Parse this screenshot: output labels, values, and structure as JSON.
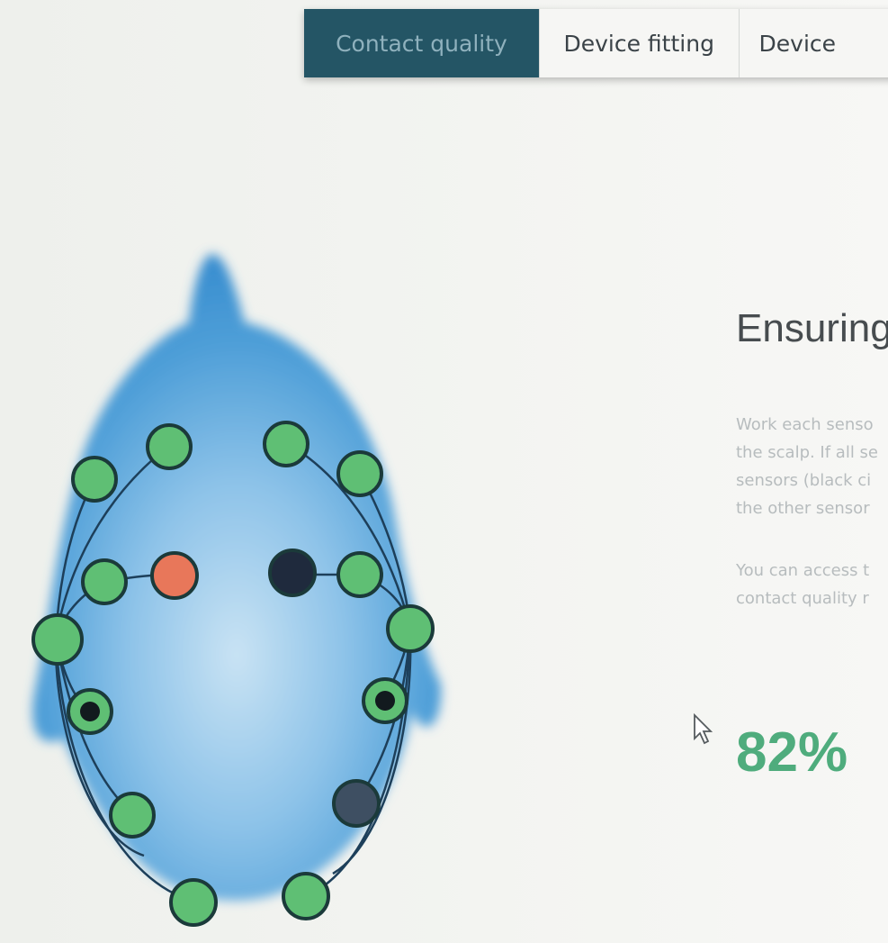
{
  "tabs": [
    {
      "label": "Contact quality",
      "active": true
    },
    {
      "label": "Device fitting",
      "active": false
    },
    {
      "label": "Device",
      "active": false
    }
  ],
  "info": {
    "heading": "Ensuring",
    "paragraph1": [
      "Work each senso",
      "the scalp. If all se",
      "sensors (black ci",
      "the other sensor"
    ],
    "paragraph2": [
      "You can access t",
      "contact quality r"
    ]
  },
  "contact_quality_percent": "82%",
  "colors": {
    "tab_active_bg": "#245565",
    "sensor_good": "#5fbf74",
    "sensor_fair": "#e8775a",
    "sensor_none": "#1f2a3d",
    "sensor_reference": "#3e4f62",
    "percent": "#4fac7d",
    "head": "#4b9bd6"
  },
  "sensors": [
    {
      "id": "left-front-upper",
      "status": "good"
    },
    {
      "id": "left-front-outer",
      "status": "good"
    },
    {
      "id": "left-mid-inner",
      "status": "good"
    },
    {
      "id": "left-mid-center",
      "status": "fair"
    },
    {
      "id": "left-temporal",
      "status": "good"
    },
    {
      "id": "left-reference",
      "status": "reference"
    },
    {
      "id": "left-lower",
      "status": "good"
    },
    {
      "id": "left-occipital",
      "status": "good"
    },
    {
      "id": "right-front-upper",
      "status": "good"
    },
    {
      "id": "right-front-outer",
      "status": "good"
    },
    {
      "id": "right-mid-center",
      "status": "no-contact"
    },
    {
      "id": "right-mid-inner",
      "status": "good"
    },
    {
      "id": "right-temporal",
      "status": "good"
    },
    {
      "id": "right-reference",
      "status": "reference"
    },
    {
      "id": "right-lower",
      "status": "no-contact"
    },
    {
      "id": "right-occipital",
      "status": "good"
    }
  ]
}
